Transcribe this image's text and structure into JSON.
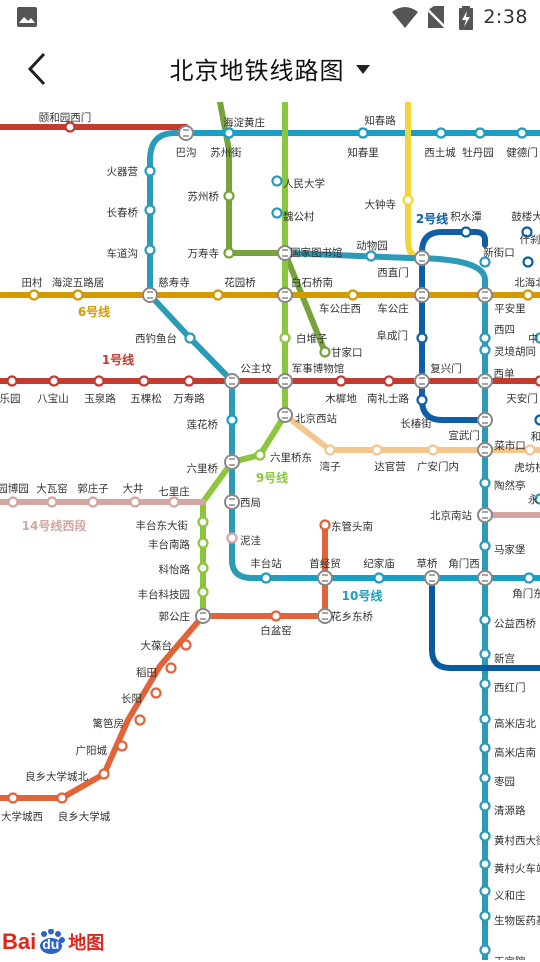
{
  "status_bar": {
    "time": "2:38",
    "icons": [
      "image-icon",
      "wifi-icon",
      "no-sim-icon",
      "battery-charging-icon"
    ]
  },
  "app_bar": {
    "title": "北京地铁线路图",
    "back_icon": "chevron-left-icon",
    "dropdown_icon": "caret-down-icon"
  },
  "colors": {
    "line1": "#c23a30",
    "line2": "#0f5fa6",
    "line4": "#2c9bb8",
    "line5": "#efd73a",
    "line6": "#d29a00",
    "line7": "#f3c68e",
    "line9": "#8cc63f",
    "line10": "#1b9ec4",
    "line14": "#d3a6a2",
    "fangshan": "#e06339",
    "line16": "#76a33a",
    "line13": "#0a5aa0"
  },
  "line_labels": {
    "line1": "1号线",
    "line2": "2号线",
    "line6": "6号线",
    "line9": "9号线",
    "line10": "10号线",
    "line14": "14号线西段"
  },
  "stations": {
    "yiheyuan_ximen": "颐和园西门",
    "haidian_huangzhuang": "海淀黄庄",
    "zhichunlu": "知春路",
    "bagou": "巴沟",
    "suzhoujie": "苏州街",
    "zhichunli": "知春里",
    "xitucheng": "西土城",
    "mudanyuan": "牡丹园",
    "jiande_men": "健德门",
    "huoqiying": "火器营",
    "suzhouqiao": "苏州桥",
    "renmin_daxue": "人民大学",
    "changchunqiao": "长春桥",
    "weigongcun": "魏公村",
    "dazhongsi": "大钟寺",
    "jishuitan": "积水潭",
    "gulou_dajie": "鼓楼大",
    "chedaogou": "车道沟",
    "wanshousi": "万寿寺",
    "guojia_tushuguan": "国家图书馆",
    "dongwuyuan": "动物园",
    "xinjiekou": "新街口",
    "shichahai": "什刹",
    "tiancun": "田村",
    "haidian_wulubao": "海淀五路居",
    "cishousi": "慈寿寺",
    "huayuanqiao": "花园桥",
    "baishiqiao_nan": "白石桥南",
    "xizhimen": "西直门",
    "beihai_bei": "北海北",
    "chegongzhuang_xi": "车公庄西",
    "chegongzhuang": "车公庄",
    "pinganli": "平安里",
    "xidiaoyutai": "西钓鱼台",
    "baiduizi": "白堆子",
    "fuchengmen": "阜成门",
    "xisi": "西四",
    "ganjiakou": "甘家口",
    "zhongnanhai": "中",
    "lingjing_hutong": "灵境胡同",
    "gongzhufen": "公主坟",
    "junshi_bowuguan": "军事博物馆",
    "xidan": "西单",
    "leyuan": "乐园",
    "babaoshan": "八宝山",
    "yuquanlu": "玉泉路",
    "wukesong": "五棵松",
    "wanshoulu": "万寿路",
    "muxidi": "木樨地",
    "nanlishilu": "南礼士路",
    "fuxingmen": "复兴门",
    "tiananmen_xi": "天安门",
    "lianhuaqiao": "莲花桥",
    "beijing_xizhan": "北京西站",
    "changchunjie": "长椿街",
    "xuanwumen": "宣武门",
    "he": "和",
    "caishikou": "菜市口",
    "liuliqiao": "六里桥",
    "liuliqiao_dong": "六里桥东",
    "wanzi": "湾子",
    "daguanying": "达官营",
    "guanganmennei": "广安门内",
    "hufangqiao": "虎坊桥",
    "yuanboyuan": "园博园",
    "dawayao": "大瓦窑",
    "guozhuangzi": "郭庄子",
    "dajing": "大井",
    "qilizhuang": "七里庄",
    "xiju": "西局",
    "taoranting": "陶然亭",
    "yongdingmen": "永",
    "fengtai_dongdajie": "丰台东大街",
    "fengtai_nanlu": "丰台南路",
    "nijie": "泥洼",
    "beijing_nanzhan": "北京南站",
    "dongguantounan": "东管头南",
    "majiabao": "马家堡",
    "kejilu": "科怡路",
    "fengtaizhan": "丰台站",
    "shoujingmao": "首经贸",
    "jijiamiao": "纪家庙",
    "caoqiao": "草桥",
    "jiaomenxi": "角门西",
    "jiaomendong": "角门东",
    "fengtai_kejiyuan": "丰台科技园",
    "guogongzhuang": "郭公庄",
    "baipengyao": "白盆窑",
    "huaxiang_dongqiao": "花乡东桥",
    "gongyi_xiqiao": "公益西桥",
    "dabaotai": "大葆台",
    "daotian": "稻田",
    "xingong": "新宫",
    "changyang": "长阳",
    "xihongmen": "西红门",
    "libafang": "篱笆房",
    "gaomidianbei": "高米店北",
    "guangyangcheng": "广阳城",
    "gaomidiannan": "高米店南",
    "liangxiang_daxuecheng_bei": "良乡大学城北",
    "zaoyuan": "枣园",
    "qingyuanlu": "清源路",
    "daxuechengxi": "大学城西",
    "liangxiang_daxuecheng": "良乡大学城",
    "huangcun_xidajie": "黄村西大街",
    "huangcun_huochezhan": "黄村火车站",
    "yihezhuang": "义和庄",
    "shengwu_yiyao_jidi": "生物医药基",
    "tianguyuan": "天宫院"
  },
  "watermark": {
    "brand": "Bai",
    "paw": "du",
    "suffix": "地图"
  }
}
